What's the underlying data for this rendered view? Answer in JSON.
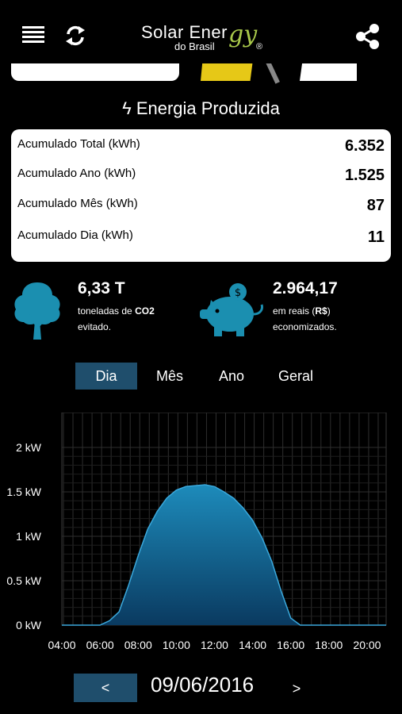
{
  "header": {
    "logo_main": "Solar Ener",
    "logo_script": "gy",
    "logo_reg": "®",
    "logo_sub": "do Brasil"
  },
  "section": {
    "bolt": "ϟ",
    "title": "Energia Produzida"
  },
  "energy": [
    {
      "label": "Acumulado Total (kWh)",
      "value": "6.352"
    },
    {
      "label": "Acumulado Ano (kWh)",
      "value": "1.525"
    },
    {
      "label": "Acumulado Mês (kWh)",
      "value": "87"
    },
    {
      "label": "Acumulado Dia (kWh)",
      "value": "11"
    }
  ],
  "stats": {
    "co2": {
      "value": "6,33 T",
      "line1_pre": "toneladas de ",
      "line1_bold": "CO2",
      "line2": "evitado."
    },
    "money": {
      "value": "2.964,17",
      "line1_pre": "em reais (",
      "line1_bold": "R$",
      "line1_post": ")",
      "line2": "economizados."
    }
  },
  "tabs": [
    {
      "label": "Dia",
      "active": true
    },
    {
      "label": "Mês",
      "active": false
    },
    {
      "label": "Ano",
      "active": false
    },
    {
      "label": "Geral",
      "active": false
    }
  ],
  "nav": {
    "prev": "<",
    "date": "09/06/2016",
    "next": ">"
  },
  "colors": {
    "accent": "#1f4e6c",
    "icon": "#1b8fb0",
    "area_top": "#1d8bbb",
    "area_bottom": "#0a3a60"
  },
  "chart_data": {
    "type": "area",
    "ylabels": [
      "2 kW",
      "1.5 kW",
      "1 kW",
      "0.5 kW",
      "0 kW"
    ],
    "yticks": [
      2,
      1.5,
      1,
      0.5,
      0
    ],
    "ylim": [
      0,
      2
    ],
    "xlabels": [
      "04:00",
      "06:00",
      "08:00",
      "10:00",
      "12:00",
      "14:00",
      "16:00",
      "18:00",
      "20:00"
    ],
    "xticks": [
      4,
      6,
      8,
      10,
      12,
      14,
      16,
      18,
      20
    ],
    "xlim": [
      4,
      21
    ],
    "grid": true,
    "x": [
      4,
      6.0,
      6.5,
      7.0,
      7.5,
      8.0,
      8.5,
      9.0,
      9.5,
      10.0,
      10.5,
      11.0,
      11.5,
      12.0,
      12.5,
      13.0,
      13.5,
      14.0,
      14.5,
      15.0,
      15.5,
      16.0,
      16.5,
      21
    ],
    "y": [
      0,
      0,
      0.05,
      0.15,
      0.45,
      0.78,
      1.08,
      1.28,
      1.43,
      1.52,
      1.56,
      1.57,
      1.58,
      1.56,
      1.5,
      1.43,
      1.32,
      1.18,
      0.98,
      0.72,
      0.38,
      0.08,
      0.0,
      0
    ]
  }
}
